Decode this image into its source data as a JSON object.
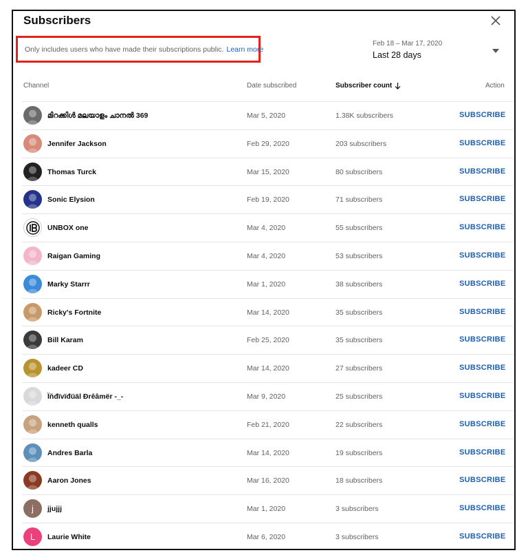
{
  "dialog": {
    "title": "Subscribers",
    "notice_text": "Only includes users who have made their subscriptions public.",
    "learn_more": "Learn more"
  },
  "date_range": {
    "dates": "Feb 18 – Mar 17, 2020",
    "label": "Last 28 days"
  },
  "columns": {
    "channel": "Channel",
    "date": "Date subscribed",
    "count": "Subscriber count",
    "action": "Action"
  },
  "subscribe_label": "SUBSCRIBE",
  "rows": [
    {
      "name": "മിറക്കിൾ മലയാളം ചാനൽ 369",
      "date": "Mar 5, 2020",
      "count": "1.38K subscribers",
      "avatar_color": "#6b6b6b",
      "avatar_icon": "person-photo"
    },
    {
      "name": "Jennifer Jackson",
      "date": "Feb 29, 2020",
      "count": "203 subscribers",
      "avatar_color": "#d88a7a",
      "avatar_icon": "cartoon-photo"
    },
    {
      "name": "Thomas Turck",
      "date": "Mar 15, 2020",
      "count": "80 subscribers",
      "avatar_color": "#222222",
      "avatar_icon": "person-photo"
    },
    {
      "name": "Sonic Elysion",
      "date": "Feb 19, 2020",
      "count": "71 subscribers",
      "avatar_color": "#23328a",
      "avatar_icon": "anime-photo"
    },
    {
      "name": "UNBOX one",
      "date": "Mar 4, 2020",
      "count": "55 subscribers",
      "avatar_color": "#ffffff",
      "avatar_icon": "logo"
    },
    {
      "name": "Raigan Gaming",
      "date": "Mar 4, 2020",
      "count": "53 subscribers",
      "avatar_color": "#f2b6c8",
      "avatar_icon": "hearts-photo"
    },
    {
      "name": "Marky Starrr",
      "date": "Mar 1, 2020",
      "count": "38 subscribers",
      "avatar_color": "#3c8bd8",
      "avatar_icon": "person-photo"
    },
    {
      "name": "Ricky's Fortnite",
      "date": "Mar 14, 2020",
      "count": "35 subscribers",
      "avatar_color": "#c89a6a",
      "avatar_icon": "dog-photo"
    },
    {
      "name": "Bill Karam",
      "date": "Feb 25, 2020",
      "count": "35 subscribers",
      "avatar_color": "#3a3a3a",
      "avatar_icon": "person-photo"
    },
    {
      "name": "kadeer CD",
      "date": "Mar 14, 2020",
      "count": "27 subscribers",
      "avatar_color": "#b8932f",
      "avatar_icon": "person-photo"
    },
    {
      "name": "Ïňđïvïđüäl Ðrêâmër -_-",
      "date": "Mar 9, 2020",
      "count": "25 subscribers",
      "avatar_color": "#d9d9d9",
      "avatar_icon": "person-photo"
    },
    {
      "name": "kenneth qualls",
      "date": "Feb 21, 2020",
      "count": "22 subscribers",
      "avatar_color": "#c7a27e",
      "avatar_icon": "person-photo"
    },
    {
      "name": "Andres Barla",
      "date": "Mar 14, 2020",
      "count": "19 subscribers",
      "avatar_color": "#5d8fb8",
      "avatar_icon": "person-photo"
    },
    {
      "name": "Aaron Jones",
      "date": "Mar 16, 2020",
      "count": "18 subscribers",
      "avatar_color": "#8a3a22",
      "avatar_icon": "person-photo"
    },
    {
      "name": "jjujjj",
      "date": "Mar 1, 2020",
      "count": "3 subscribers",
      "avatar_color": "#8d6e63",
      "avatar_icon": "letter",
      "avatar_letter": "j"
    },
    {
      "name": "Laurie White",
      "date": "Mar 6, 2020",
      "count": "3 subscribers",
      "avatar_color": "#ec407a",
      "avatar_icon": "letter",
      "avatar_letter": "L"
    }
  ]
}
